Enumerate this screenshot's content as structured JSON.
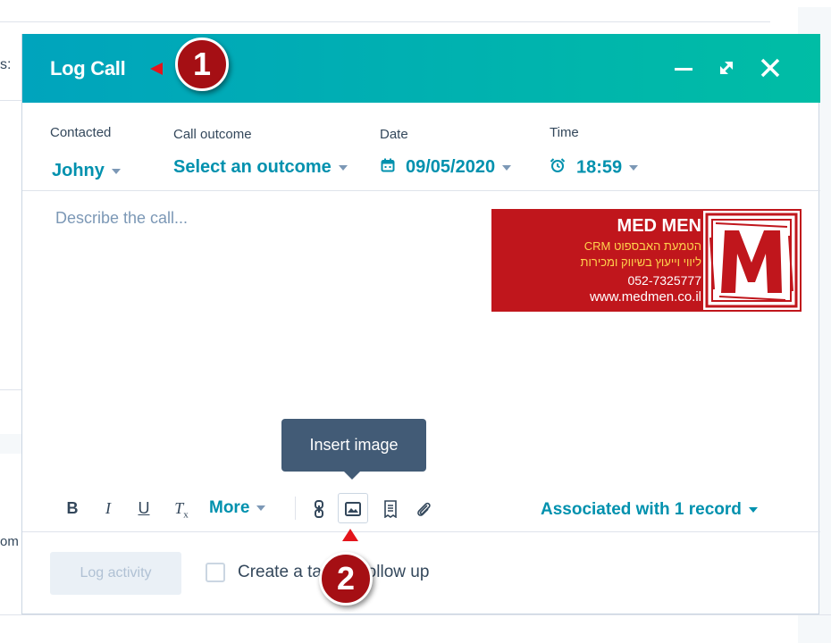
{
  "background": {
    "partial_label": "s:",
    "partial_text_bottom": "om"
  },
  "modal": {
    "title": "Log Call",
    "header_icons": [
      "minimize-icon",
      "expand-icon",
      "close-icon"
    ],
    "accent_colors": [
      "#00a4bd",
      "#00bda5"
    ]
  },
  "fields": {
    "contacted": {
      "label": "Contacted",
      "value": "Johny"
    },
    "outcome": {
      "label": "Call outcome",
      "value": "Select an outcome"
    },
    "date": {
      "label": "Date",
      "value": "09/05/2020"
    },
    "time": {
      "label": "Time",
      "value": "18:59"
    }
  },
  "editor": {
    "placeholder": "Describe the call..."
  },
  "signature": {
    "title": "MED MEN",
    "line1": "הטמעת האבספוט CRM",
    "line2": "ליווי וייעוץ בשיווק ומכירות",
    "phone": "052-7325777",
    "website": "www.medmen.co.il",
    "logo_letter": "M",
    "colors": {
      "background": "#c0161c",
      "accent_text": "#ffd34d"
    }
  },
  "toolbar": {
    "bold": "B",
    "italic": "I",
    "underline": "U",
    "clear_format": "T",
    "clear_format_sub": "x",
    "more": "More",
    "tooltip": "Insert image",
    "associated": "Associated with 1 record"
  },
  "footer": {
    "log_button": "Log activity",
    "followup_label": "Create a task to follow up"
  },
  "annotations": {
    "callout_1": "1",
    "callout_2": "2"
  }
}
